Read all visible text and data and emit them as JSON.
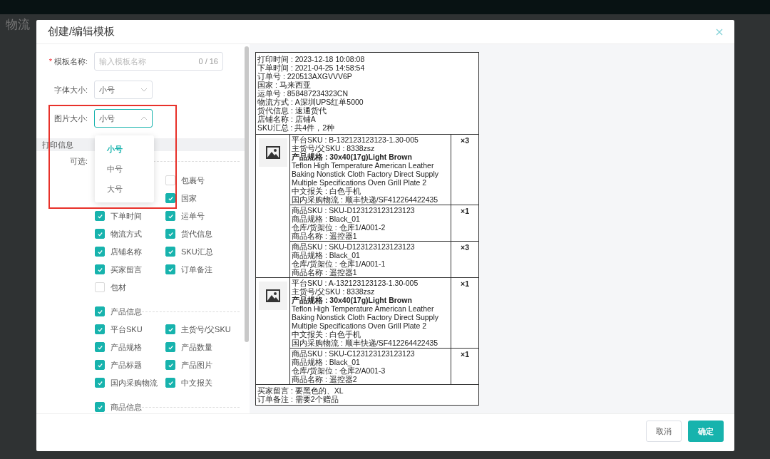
{
  "page": {
    "title": "物流"
  },
  "modal": {
    "title": "创建/编辑模板",
    "form": [
      {
        "kind": "text",
        "label": "模板名称:",
        "required_mark": "*",
        "placeholder": "输入模板名称",
        "count": "0 / 16"
      },
      {
        "kind": "select",
        "label": "字体大小:",
        "value": "小号",
        "open": false
      },
      {
        "kind": "select",
        "label": "图片大小:",
        "value": "小号",
        "open": true,
        "highlighted": true,
        "options": [
          {
            "label": "小号",
            "selected": true
          },
          {
            "label": "中号",
            "selected": false
          },
          {
            "label": "大号",
            "selected": false
          }
        ]
      }
    ],
    "print_info": {
      "title": "打印信息",
      "optional_label": "可选:",
      "rows": [
        {
          "right": {
            "label": "包裹号",
            "checked": false
          }
        },
        {
          "right": {
            "label": "国家",
            "checked": true
          }
        },
        {
          "left": {
            "label": "下单时间",
            "checked": true
          },
          "right": {
            "label": "运单号",
            "checked": true
          }
        },
        {
          "left": {
            "label": "物流方式",
            "checked": true
          },
          "right": {
            "label": "货代信息",
            "checked": true
          }
        },
        {
          "left": {
            "label": "店铺名称",
            "checked": true
          },
          "right": {
            "label": "SKU汇总",
            "checked": true
          }
        },
        {
          "left": {
            "label": "买家留言",
            "checked": true
          },
          "right": {
            "label": "订单备注",
            "checked": true
          }
        },
        {
          "left": {
            "label": "包材",
            "checked": false
          }
        }
      ],
      "groups": [
        {
          "label": "产品信息",
          "checked": true,
          "rows": [
            {
              "left": {
                "label": "平台SKU",
                "checked": true
              },
              "right": {
                "label": "主货号/父SKU",
                "checked": true
              }
            },
            {
              "left": {
                "label": "产品规格",
                "checked": true
              },
              "right": {
                "label": "产品数量",
                "checked": true
              }
            },
            {
              "left": {
                "label": "产品标题",
                "checked": true
              },
              "right": {
                "label": "产品图片",
                "checked": true
              }
            },
            {
              "left": {
                "label": "国内采购物流",
                "checked": true
              },
              "right": {
                "label": "中文报关",
                "checked": true
              }
            }
          ]
        },
        {
          "label": "商品信息",
          "checked": true
        }
      ]
    },
    "preview": {
      "header_lines": [
        "打印时间 : 2023-12-18 10:08:08",
        "下单时间 : 2021-04-25 14:58:54",
        "订单号 : 220513AXGVVV6P",
        "国家 : 马来西亚",
        "运单号 : 858487234323CN",
        "物流方式 : A深圳UPS红单5000",
        "货代信息 : 速通货代",
        "店铺名称 : 店铺A",
        "SKU汇总 : 共4件，2种"
      ],
      "groups": [
        {
          "items": [
            {
              "qty": "×3",
              "lines": [
                {
                  "text": "平台SKU : B-132123123123-1.30-005",
                  "bold": false
                },
                {
                  "text": "主货号/父SKU : 8338zsz",
                  "bold": false
                },
                {
                  "text": "产品规格 : 30x40(17g)Light Brown",
                  "bold": true
                },
                {
                  "text": "Teflon High Temperature American Leather Baking Nonstick Cloth Factory Direct Supply Multiple Specifications Oven Grill Plate 2",
                  "bold": false
                },
                {
                  "text": "中文报关 : 白色手机",
                  "bold": false
                },
                {
                  "text": "国内采购物流 : 顺丰快递/SF412264422435",
                  "bold": false
                }
              ]
            },
            {
              "qty": "×1",
              "lines": [
                {
                  "text": "商品SKU : SKU-D123123123123123",
                  "bold": false
                },
                {
                  "text": "商品规格 : Black_01",
                  "bold": false
                },
                {
                  "text": "仓库/货架位 : 仓库1/A001-2",
                  "bold": false
                },
                {
                  "text": "商品名称 : 遥控器1",
                  "bold": false
                }
              ]
            },
            {
              "qty": "×3",
              "lines": [
                {
                  "text": "商品SKU : SKU-D123123123123123",
                  "bold": false
                },
                {
                  "text": "商品规格 : Black_01",
                  "bold": false
                },
                {
                  "text": "仓库/货架位 : 仓库1/A001-1",
                  "bold": false
                },
                {
                  "text": "商品名称 : 遥控器1",
                  "bold": false
                }
              ]
            }
          ]
        },
        {
          "items": [
            {
              "qty": "×1",
              "lines": [
                {
                  "text": "平台SKU : A-132123123123-1.30-005",
                  "bold": false
                },
                {
                  "text": "主货号/父SKU : 8338zsz",
                  "bold": false
                },
                {
                  "text": "产品规格 : 30x40(17g)Light Brown",
                  "bold": true
                },
                {
                  "text": "Teflon High Temperature American Leather Baking Nonstick Cloth Factory Direct Supply Multiple Specifications Oven Grill Plate 2",
                  "bold": false
                },
                {
                  "text": "中文报关 : 白色手机",
                  "bold": false
                },
                {
                  "text": "国内采购物流 : 顺丰快递/SF412264422435",
                  "bold": false
                }
              ]
            },
            {
              "qty": "×1",
              "lines": [
                {
                  "text": "商品SKU : SKU-C123123123123123",
                  "bold": false
                },
                {
                  "text": "商品规格 : Black_01",
                  "bold": false
                },
                {
                  "text": "仓库/货架位 : 仓库2/A001-3",
                  "bold": false
                },
                {
                  "text": "商品名称 : 遥控器2",
                  "bold": false
                }
              ]
            }
          ]
        }
      ],
      "footer_lines": [
        "买家留言 : 要黑色的、XL",
        "订单备注 : 需要2个赠品"
      ]
    },
    "buttons": [
      {
        "label": "取消",
        "kind": "secondary"
      },
      {
        "label": "确定",
        "kind": "primary"
      }
    ]
  }
}
